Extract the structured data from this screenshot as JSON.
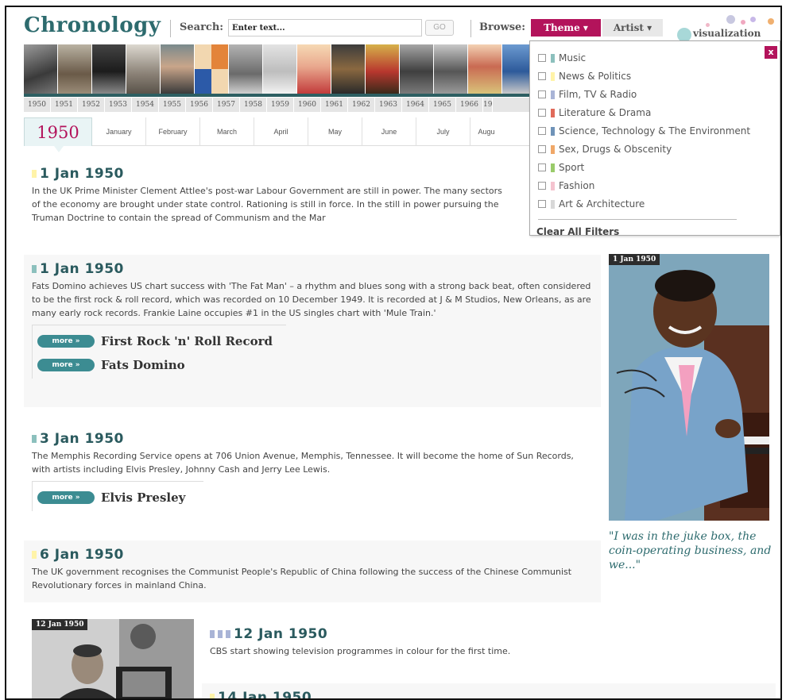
{
  "header": {
    "logo": "Chronology",
    "search_label": "Search:",
    "search_placeholder": "Enter text...",
    "go_label": "GO",
    "browse_label": "Browse:",
    "theme_label": "Theme ▾",
    "artist_label": "Artist ▾",
    "visualization_label": "visualization"
  },
  "years": [
    "1950",
    "1951",
    "1952",
    "1953",
    "1954",
    "1955",
    "1956",
    "1957",
    "1958",
    "1959",
    "1960",
    "1961",
    "1962",
    "1963",
    "1964",
    "1965",
    "1966",
    "19"
  ],
  "current_year": "1950",
  "months": [
    "January",
    "February",
    "March",
    "April",
    "May",
    "June",
    "July",
    "Augu"
  ],
  "entries": [
    {
      "date": "1 Jan 1950",
      "swatch": "#fff3a8",
      "text": "In the UK Prime Minister Clement Attlee's post-war Labour Government are still in power. The many sectors of the economy are brought under state control. Rationing is still in force. In the still in power pursuing the Truman Doctrine to contain the spread of Communism and the Mar"
    },
    {
      "date": "1 Jan 1950",
      "swatch": "#8cc0bd",
      "text": "Fats Domino achieves US chart success with 'The Fat Man' – a rhythm and blues song with a strong back beat, often considered to be the first rock & roll record, which was recorded on 10 December 1949. It is recorded at J & M Studios, New Orleans, as are many early rock records. Frankie Laine occupies #1 in the US singles chart with 'Mule Train.'",
      "more": [
        "First Rock 'n' Roll Record",
        "Fats Domino"
      ]
    },
    {
      "date": "3 Jan 1950",
      "swatch": "#8cc0bd",
      "text": "The Memphis Recording Service opens at 706 Union Avenue, Memphis, Tennessee. It will become the home of Sun Records, with artists including Elvis Presley, Johnny Cash and Jerry Lee Lewis.",
      "more": [
        "Elvis Presley"
      ]
    },
    {
      "date": "6 Jan 1950",
      "swatch": "#fff3a8",
      "text": "The UK government recognises the Communist People's Republic of China following the success of the Chinese Communist Revolutionary forces in mainland China."
    },
    {
      "date": "12 Jan 1950",
      "swatch": "#a9b4d6",
      "text": "CBS start showing television programmes in colour for the first time."
    },
    {
      "date": "14 Jan 1950",
      "swatch": "#fff3a8"
    }
  ],
  "more_label": "more »",
  "photos": {
    "fats_tag": "1 Jan 1950",
    "tv_tag": "12 Jan 1950",
    "quote": "\"I was in the juke box, the coin-operating business, and we...\""
  },
  "theme_filters": [
    {
      "label": "Music",
      "color": "#8cc0bd"
    },
    {
      "label": "News & Politics",
      "color": "#fff3a8"
    },
    {
      "label": "Film, TV & Radio",
      "color": "#a9b4d6"
    },
    {
      "label": "Literature & Drama",
      "color": "#e06a5a"
    },
    {
      "label": "Science, Technology & The Environment",
      "color": "#6f93b8"
    },
    {
      "label": "Sex, Drugs & Obscenity",
      "color": "#f0a868"
    },
    {
      "label": "Sport",
      "color": "#9acb6a"
    },
    {
      "label": "Fashion",
      "color": "#f4c3cf"
    },
    {
      "label": "Art & Architecture",
      "color": "#d8d8d8"
    }
  ],
  "clear_filters": "Clear All Filters",
  "close_label": "x"
}
